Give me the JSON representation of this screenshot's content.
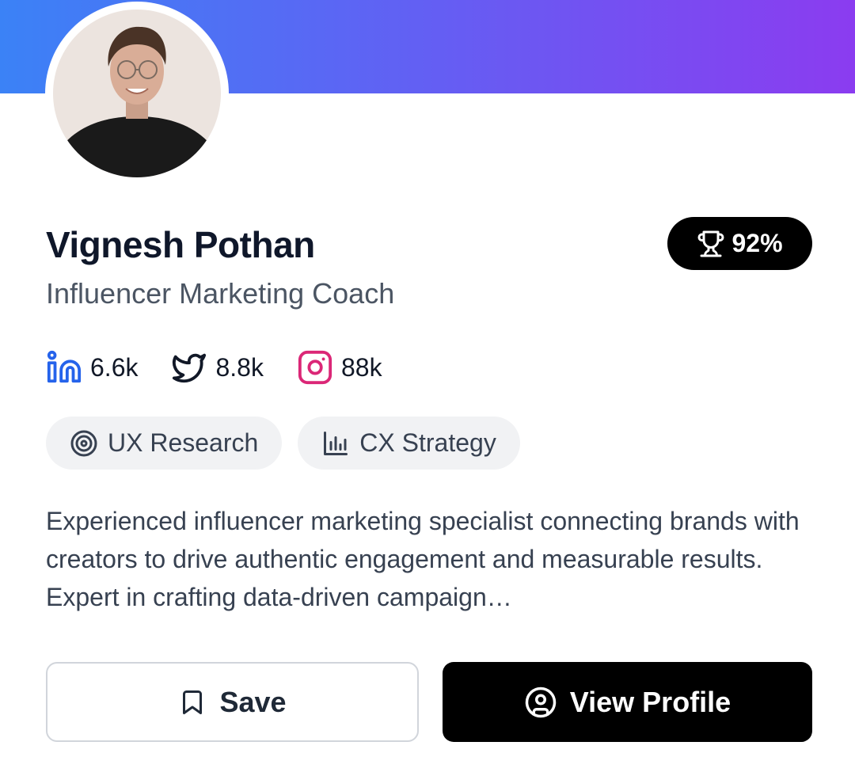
{
  "profile": {
    "name": "Vignesh Pothan",
    "title": "Influencer Marketing Coach",
    "score": "92%"
  },
  "socials": [
    {
      "network": "linkedin-icon",
      "count": "6.6k",
      "color": "#2563eb"
    },
    {
      "network": "twitter-icon",
      "count": "8.8k",
      "color": "#111827"
    },
    {
      "network": "instagram-icon",
      "count": "88k",
      "color": "#db2777"
    }
  ],
  "tags": [
    {
      "icon": "target-icon",
      "label": "UX Research"
    },
    {
      "icon": "bar-chart-icon",
      "label": "CX Strategy"
    }
  ],
  "bio": "Experienced influencer marketing specialist connecting brands with creators to drive authentic engagement and measurable results. Expert in crafting data-driven campaign…",
  "actions": {
    "save_label": "Save",
    "view_label": "View Profile"
  },
  "colors": {
    "banner_start": "#3b82f6",
    "banner_end": "#8b3cf0"
  }
}
